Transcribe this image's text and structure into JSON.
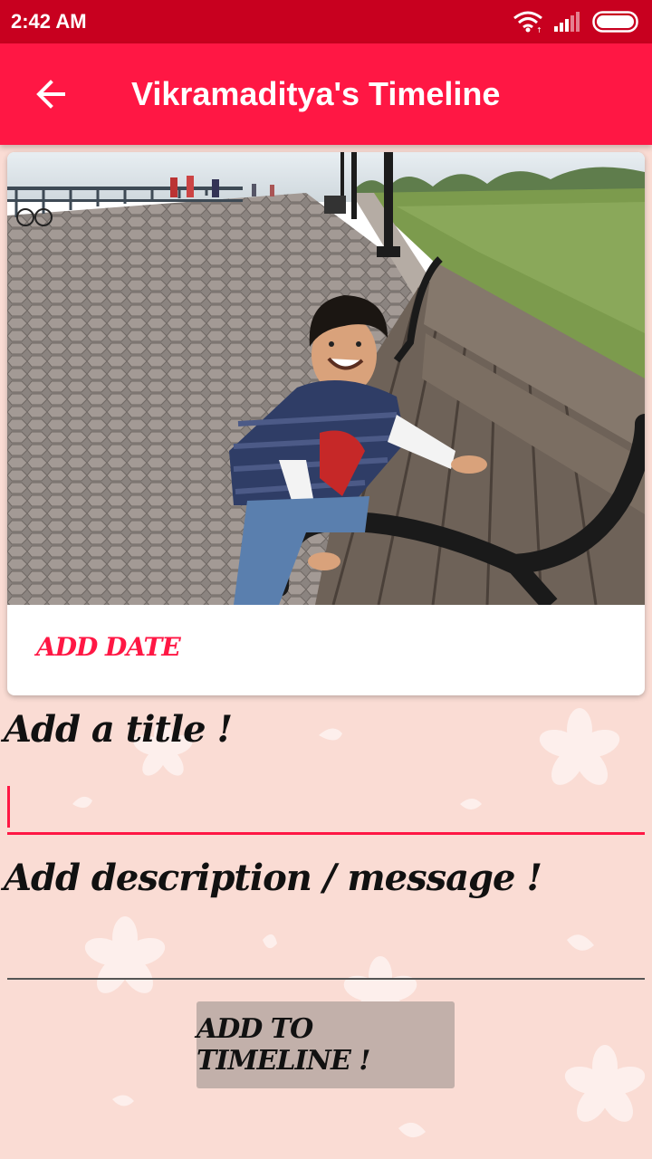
{
  "status_bar": {
    "time": "2:42 AM",
    "icons": [
      "wifi-icon",
      "signal-icon",
      "battery-icon"
    ]
  },
  "app_bar": {
    "back_icon": "arrow-left-icon",
    "title": "Vikramaditya's Timeline"
  },
  "card": {
    "photo_description": "child-on-park-bench",
    "add_date_label": "ADD DATE"
  },
  "form": {
    "title_label": "Add a title !",
    "title_value": "",
    "description_label": "Add description / message !",
    "description_value": "",
    "submit_label": "ADD TO TIMELINE !"
  },
  "colors": {
    "primary": "#ff1744",
    "primary_dark": "#c8001f",
    "background": "#fadcd4",
    "button": "#c2b0aa"
  }
}
